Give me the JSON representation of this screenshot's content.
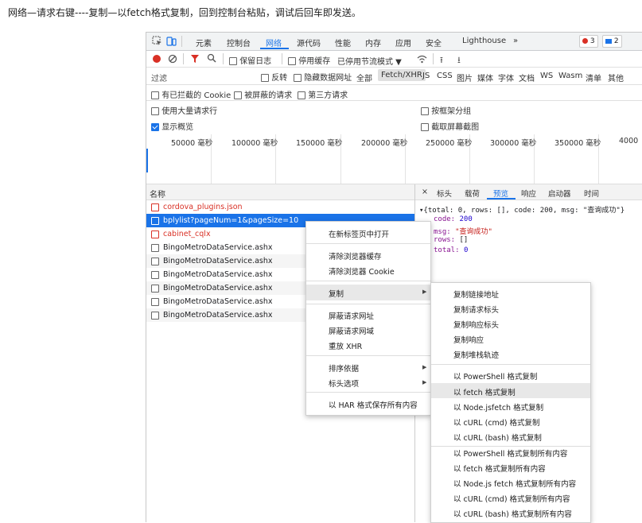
{
  "caption": "网络—请求右键----复制—以fetch格式复制，回到控制台粘贴，调试后回车即发送。",
  "devtools": {
    "tabs": [
      "元素",
      "控制台",
      "网络",
      "源代码",
      "性能",
      "内存",
      "应用",
      "安全",
      "Lighthouse",
      "»"
    ],
    "active_tab": "网络",
    "error_count": "3",
    "message_count": "2",
    "toolbar": {
      "preserve_log": "保留日志",
      "disable_cache": "停用缓存",
      "throttling": "已停用节流模式"
    },
    "filter": {
      "placeholder": "过滤",
      "invert": "反转",
      "hide_data_urls": "隐藏数据网址",
      "types": [
        "全部",
        "Fetch/XHR",
        "JS",
        "CSS",
        "图片",
        "媒体",
        "字体",
        "文档",
        "WS",
        "Wasm",
        "清单",
        "其他"
      ],
      "active_type": "Fetch/XHR"
    },
    "options": {
      "blocked_cookies": "有已拦截的 Cookie",
      "blocked_requests": "被屏蔽的请求",
      "third_party": "第三方请求",
      "big_rows": "使用大量请求行",
      "group_by_frame": "按框架分组",
      "show_overview": "显示概览",
      "capture_screenshots": "截取屏幕截图"
    },
    "timeline_ticks": [
      "50000 毫秒",
      "100000 毫秒",
      "150000 毫秒",
      "200000 毫秒",
      "250000 毫秒",
      "300000 毫秒",
      "350000 毫秒",
      "4000"
    ],
    "list_header": "名称",
    "requests": [
      {
        "name": "cordova_plugins.json",
        "status": "error"
      },
      {
        "name": "bplylist?pageNum=1&pageSize=10",
        "status": "selected"
      },
      {
        "name": "cabinet_cqlx",
        "status": "error"
      },
      {
        "name": "BingoMetroDataService.ashx",
        "status": "ok"
      },
      {
        "name": "BingoMetroDataService.ashx",
        "status": "ok"
      },
      {
        "name": "BingoMetroDataService.ashx",
        "status": "ok"
      },
      {
        "name": "BingoMetroDataService.ashx",
        "status": "ok"
      },
      {
        "name": "BingoMetroDataService.ashx",
        "status": "ok"
      },
      {
        "name": "BingoMetroDataService.ashx",
        "status": "ok"
      }
    ],
    "detail_tabs": [
      "×",
      "标头",
      "载荷",
      "预览",
      "响应",
      "启动器",
      "时间"
    ],
    "active_detail_tab": "预览",
    "preview": {
      "summary": "▾{total: 0, rows: [], code: 200, msg: \"查询成功\"}",
      "code_key": "code:",
      "code_val": "200",
      "msg_key": "msg:",
      "msg_val": "\"查询成功\"",
      "rows_key": "rows:",
      "rows_val": "[]",
      "total_key": "total:",
      "total_val": "0"
    }
  },
  "context_menu": {
    "open_in_new_tab": "在新标签页中打开",
    "clear_cache": "清除浏览器缓存",
    "clear_cookies": "清除浏览器 Cookie",
    "copy": "复制",
    "block_url": "屏蔽请求网址",
    "block_domain": "屏蔽请求网域",
    "replay_xhr": "重放 XHR",
    "sort_by": "排序依据",
    "header_options": "标头选项",
    "save_har": "以 HAR 格式保存所有内容"
  },
  "copy_submenu": {
    "items_a": [
      "复制链接地址",
      "复制请求标头",
      "复制响应标头",
      "复制响应",
      "复制堆栈轨迹"
    ],
    "items_b": [
      "以 PowerShell 格式复制",
      "以 fetch 格式复制",
      "以 Node.jsfetch 格式复制",
      "以 cURL (cmd) 格式复制",
      "以 cURL (bash) 格式复制"
    ],
    "items_c": [
      "以 PowerShell 格式复制所有内容",
      "以 fetch 格式复制所有内容",
      "以 Node.js fetch 格式复制所有内容",
      "以 cURL (cmd) 格式复制所有内容",
      "以 cURL (bash) 格式复制所有内容"
    ],
    "highlighted": "以 fetch 格式复制"
  },
  "colors": {
    "accent": "#1a73e8",
    "error_text": "#d93025",
    "record_red": "#d93025"
  }
}
